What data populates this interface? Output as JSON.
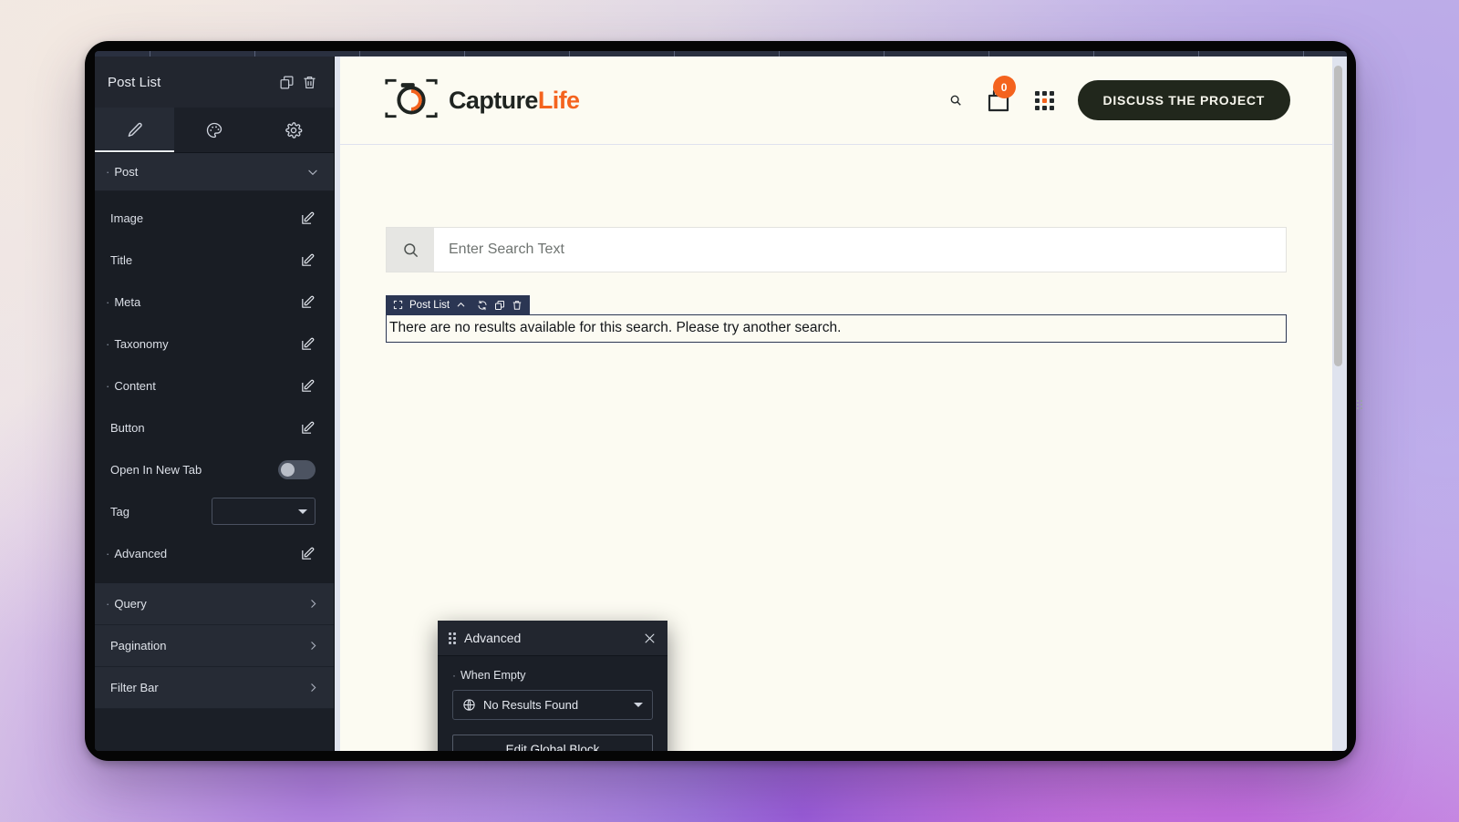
{
  "panel": {
    "title": "Post List",
    "header_icons": [
      {
        "name": "duplicate-icon"
      },
      {
        "name": "trash-icon"
      }
    ],
    "tabs": [
      {
        "label": "Content",
        "icon": "pencil-icon",
        "active": true
      },
      {
        "label": "Style",
        "icon": "palette-icon",
        "active": false
      },
      {
        "label": "Settings",
        "icon": "gear-icon",
        "active": false
      }
    ],
    "section": {
      "label": "Post",
      "bullet": "·",
      "expanded": true
    },
    "rows": [
      {
        "label": "Image",
        "bullet": "",
        "control": "edit"
      },
      {
        "label": "Title",
        "bullet": "",
        "control": "edit"
      },
      {
        "label": "Meta",
        "bullet": "·",
        "control": "edit"
      },
      {
        "label": "Taxonomy",
        "bullet": "·",
        "control": "edit"
      },
      {
        "label": "Content",
        "bullet": "·",
        "control": "edit"
      },
      {
        "label": "Button",
        "bullet": "",
        "control": "edit"
      },
      {
        "label": "Open In New Tab",
        "bullet": "",
        "control": "toggle",
        "value": "off"
      },
      {
        "label": "Tag",
        "bullet": "",
        "control": "select",
        "value": ""
      },
      {
        "label": "Advanced",
        "bullet": "·",
        "control": "edit"
      }
    ],
    "collapsed_sections": [
      {
        "label": "Query",
        "bullet": "·"
      },
      {
        "label": "Pagination",
        "bullet": ""
      },
      {
        "label": "Filter Bar",
        "bullet": ""
      }
    ]
  },
  "site": {
    "logo": {
      "icon": "camera-icon",
      "text_primary": "Capture",
      "text_accent": "Life"
    },
    "header_actions": [
      {
        "name": "search-icon"
      },
      {
        "name": "cart-icon",
        "badge": "0"
      },
      {
        "name": "apps-grid-icon"
      }
    ],
    "cta_label": "DISCUSS THE PROJECT",
    "search": {
      "placeholder": "Enter Search Text",
      "value": "",
      "icon": "search-icon"
    },
    "selection": {
      "label": "Post List",
      "icons": [
        "move-icon",
        "chevron-up-icon",
        "refresh-icon",
        "duplicate-icon",
        "trash-icon"
      ]
    },
    "empty_message": "There are no results available for this search. Please try another search."
  },
  "popup": {
    "title": "Advanced",
    "drag_icon": "drag-handle-icon",
    "close_icon": "close-icon",
    "field_label": "When Empty",
    "field_bullet": "·",
    "select_value": "No Results Found",
    "select_icon": "globe-icon",
    "button_label": "Edit Global Block"
  },
  "colors": {
    "accent_orange": "#f4631e",
    "cta_dark": "#21271c",
    "panel_bg": "#1b1f27",
    "selection_blue": "#2b3653",
    "site_bg": "#fcfbf2"
  }
}
